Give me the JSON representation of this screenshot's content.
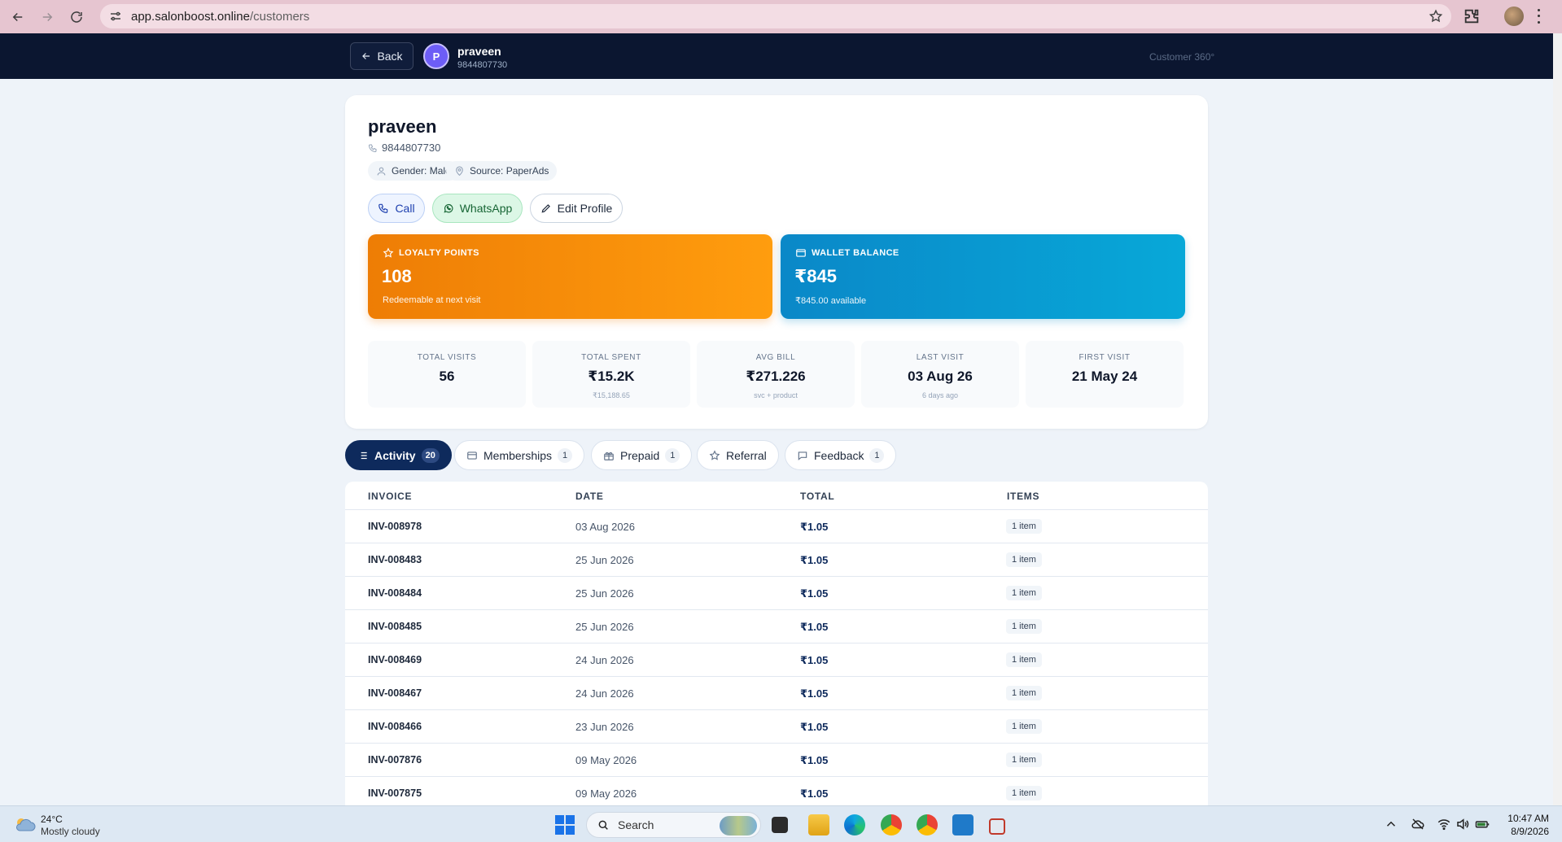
{
  "browser": {
    "url_host": "app.salonboost.online",
    "url_path": "/customers"
  },
  "header": {
    "back_label": "Back",
    "avatar_initial": "P",
    "name": "praveen",
    "phone": "9844807730",
    "right_label": "Customer 360°"
  },
  "profile": {
    "name": "praveen",
    "phone": "9844807730",
    "chips": {
      "gender": "Gender: Male",
      "source": "Source: PaperAds"
    },
    "actions": {
      "call": "Call",
      "whatsapp": "WhatsApp",
      "edit": "Edit Profile"
    },
    "loyalty": {
      "label": "LOYALTY POINTS",
      "value": "108",
      "sub": "Redeemable at next visit"
    },
    "wallet": {
      "label": "WALLET BALANCE",
      "value": "₹845",
      "sub": "₹845.00 available"
    },
    "metrics": [
      {
        "label": "TOTAL VISITS",
        "value": "56",
        "sub": ""
      },
      {
        "label": "TOTAL SPENT",
        "value": "₹15.2K",
        "sub": "₹15,188.65"
      },
      {
        "label": "AVG BILL",
        "value": "₹271.226",
        "sub": "svc + product"
      },
      {
        "label": "LAST VISIT",
        "value": "03 Aug 26",
        "sub": "6 days ago"
      },
      {
        "label": "FIRST VISIT",
        "value": "21 May 24",
        "sub": ""
      }
    ]
  },
  "tabs": [
    {
      "label": "Activity",
      "count": "20"
    },
    {
      "label": "Memberships",
      "count": "1"
    },
    {
      "label": "Prepaid",
      "count": "1"
    },
    {
      "label": "Referral",
      "count": ""
    },
    {
      "label": "Feedback",
      "count": "1"
    }
  ],
  "table": {
    "columns": [
      "INVOICE",
      "DATE",
      "TOTAL",
      "ITEMS"
    ],
    "rows": [
      {
        "invoice": "INV-008978",
        "date": "03 Aug 2026",
        "total": "₹1.05",
        "items": "1 item"
      },
      {
        "invoice": "INV-008483",
        "date": "25 Jun 2026",
        "total": "₹1.05",
        "items": "1 item"
      },
      {
        "invoice": "INV-008484",
        "date": "25 Jun 2026",
        "total": "₹1.05",
        "items": "1 item"
      },
      {
        "invoice": "INV-008485",
        "date": "25 Jun 2026",
        "total": "₹1.05",
        "items": "1 item"
      },
      {
        "invoice": "INV-008469",
        "date": "24 Jun 2026",
        "total": "₹1.05",
        "items": "1 item"
      },
      {
        "invoice": "INV-008467",
        "date": "24 Jun 2026",
        "total": "₹1.05",
        "items": "1 item"
      },
      {
        "invoice": "INV-008466",
        "date": "23 Jun 2026",
        "total": "₹1.05",
        "items": "1 item"
      },
      {
        "invoice": "INV-007876",
        "date": "09 May 2026",
        "total": "₹1.05",
        "items": "1 item"
      },
      {
        "invoice": "INV-007875",
        "date": "09 May 2026",
        "total": "₹1.05",
        "items": "1 item"
      }
    ]
  },
  "taskbar": {
    "temperature": "24°C",
    "weather": "Mostly cloudy",
    "search_label": "Search",
    "time": "10:47 AM",
    "date": "8/9/2026"
  },
  "colors": {
    "header_bg": "#0b1630",
    "active_tab": "#0e2a5c",
    "loyalty": "#ee7d05",
    "wallet": "#0a88c8"
  }
}
